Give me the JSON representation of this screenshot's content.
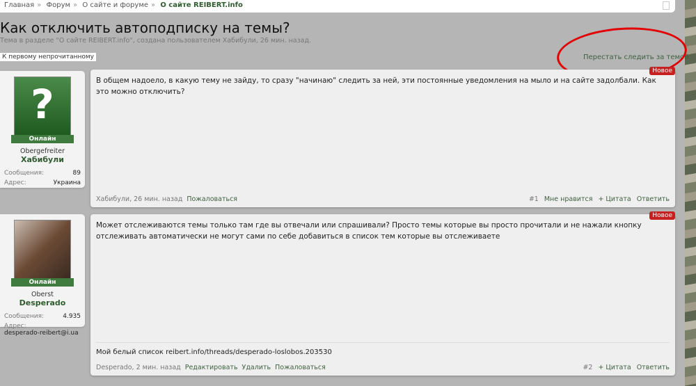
{
  "breadcrumb": [
    "Главная",
    "Форум",
    "О сайте и форуме",
    "О сайте REIBERT.info"
  ],
  "title": "Как отключить автоподписку на темы?",
  "subtitle": "Тема в разделе \"О сайте REIBERT.info\", создана пользователем Хабибули, 26 мин. назад.",
  "first_unread": "К первому непрочитанному",
  "unfollow": "Перестать следить за темой",
  "posts": [
    {
      "rank": "Obergefreiter",
      "user": "Хабибули",
      "online": "Онлайн",
      "stats": [
        {
          "k": "Сообщения:",
          "v": "89"
        },
        {
          "k": "Адрес:",
          "v": "Украина"
        }
      ],
      "text": "В общем надоело, в какую тему не зайду, то сразу \"начинаю\" следить за ней, эти постоянные уведомления на мыло и на сайте задолбали. Как это можно отключить?",
      "badge": "Новое",
      "meta": "Хабибули, 26 мин. назад",
      "links": [
        "Пожаловаться"
      ],
      "num": "#1",
      "actions": [
        "Мне нравится",
        "+ Цитата",
        "Ответить"
      ]
    },
    {
      "rank": "Oberst",
      "user": "Desperado",
      "online": "Онлайн",
      "stats": [
        {
          "k": "Сообщения:",
          "v": "4.935"
        },
        {
          "k": "Адрес:",
          "v": "desperado-reibert@i.ua"
        }
      ],
      "text": "Может отслеживаются темы только там где вы отвечали или спрашивали? Просто темы которые вы просто прочитали и не нажали кнопку отслеживать автоматически не могут сами по себе добавиться в список тем которые вы отслеживаете",
      "signature": "Мой белый список reibert.info/threads/desperado-loslobos.203530",
      "badge": "Новое",
      "meta": "Desperado, 2 мин. назад",
      "links": [
        "Редактировать",
        "Удалить",
        "Пожаловаться"
      ],
      "num": "#2",
      "actions": [
        "+ Цитата",
        "Ответить"
      ]
    }
  ]
}
